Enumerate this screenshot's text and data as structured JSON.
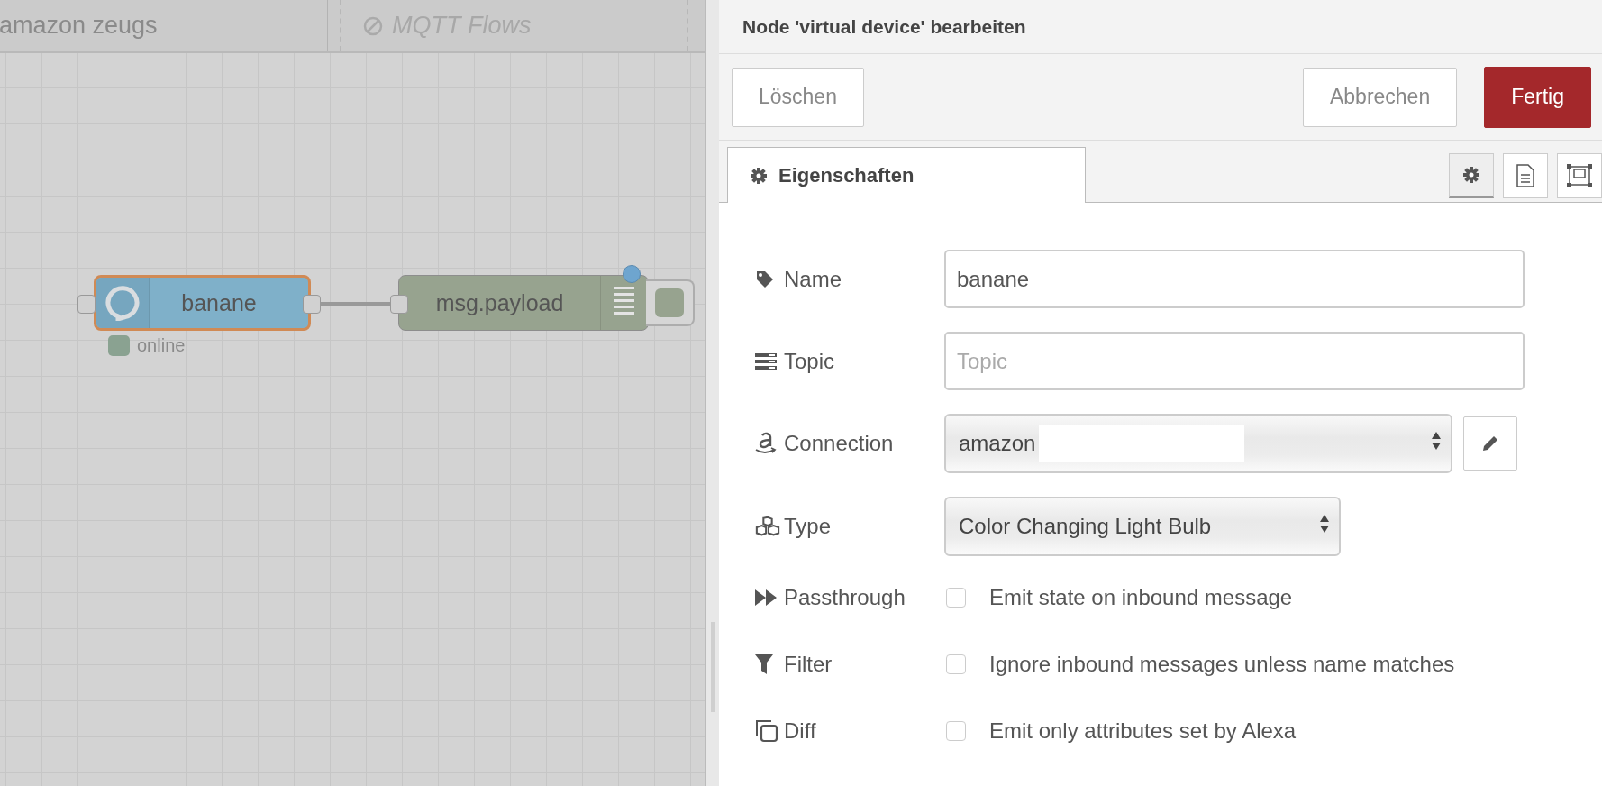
{
  "workspace_tabs": [
    {
      "label": "amazon zeugs",
      "disabled": false
    },
    {
      "label": "MQTT Flows",
      "disabled": true
    }
  ],
  "nodes": [
    {
      "kind": "alexa",
      "label": "banane",
      "selected": true,
      "changed": false,
      "status": {
        "text": "online",
        "color": "#8aa291"
      }
    },
    {
      "kind": "debug",
      "label": "msg.payload",
      "selected": false,
      "changed": true
    }
  ],
  "editor": {
    "title": "Node 'virtual device' bearbeiten",
    "buttons": [
      {
        "label": "Löschen",
        "kind": "plain"
      },
      {
        "label": "Abbrechen",
        "kind": "plain"
      },
      {
        "label": "Fertig",
        "kind": "primary"
      }
    ],
    "tab": {
      "label": "Eigenschaften",
      "selected": true
    },
    "side_tabs": [
      {
        "selected": true
      },
      {
        "selected": false
      },
      {
        "selected": false
      }
    ],
    "fields": [
      {
        "kind": "text",
        "label": "Name",
        "value": "banane"
      },
      {
        "kind": "text",
        "label": "Topic",
        "placeholder": "Topic"
      },
      {
        "kind": "select",
        "label": "Connection",
        "value": "amazon",
        "redacted": true,
        "edit_button": true
      },
      {
        "kind": "select",
        "label": "Type",
        "value": "Color Changing Light Bulb"
      },
      {
        "kind": "checkbox",
        "label": "Passthrough",
        "text": "Emit state on inbound message",
        "checked": false
      },
      {
        "kind": "checkbox",
        "label": "Filter",
        "text": "Ignore inbound messages unless name matches",
        "checked": false
      },
      {
        "kind": "checkbox",
        "label": "Diff",
        "text": "Emit only attributes set by Alexa",
        "checked": false
      }
    ]
  }
}
